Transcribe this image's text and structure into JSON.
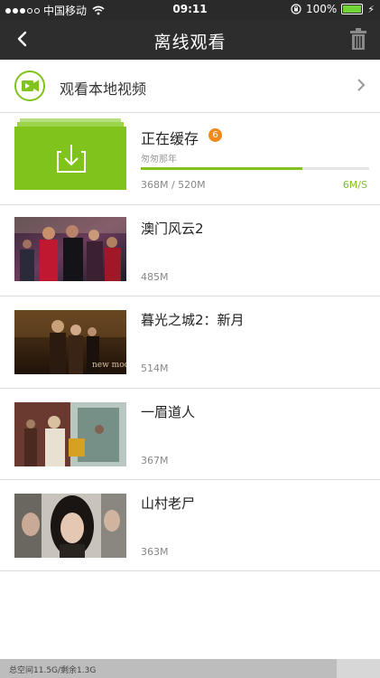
{
  "status": {
    "carrier": "中国移动",
    "time": "09:11",
    "battery": "100%"
  },
  "nav": {
    "title": "离线观看"
  },
  "local": {
    "label": "观看本地视频"
  },
  "caching": {
    "title": "正在缓存",
    "count": "6",
    "current": "匆匆那年",
    "progress_text": "368M / 520M",
    "progress_fraction": 0.708,
    "speed": "6M/S"
  },
  "videos": [
    {
      "title": "澳门风云2",
      "size": "485M"
    },
    {
      "title": "暮光之城2：新月",
      "size": "514M"
    },
    {
      "title": "一眉道人",
      "size": "367M"
    },
    {
      "title": "山村老尸",
      "size": "363M"
    }
  ],
  "thumb_text": {
    "newmoon": "new moon"
  },
  "storage": {
    "text": "总空间11.5G/剩余1.3G",
    "used_fraction": 0.887
  },
  "colors": {
    "accent": "#7fc31c",
    "badge": "#f08a1c",
    "navbar": "#2d2d2d"
  }
}
